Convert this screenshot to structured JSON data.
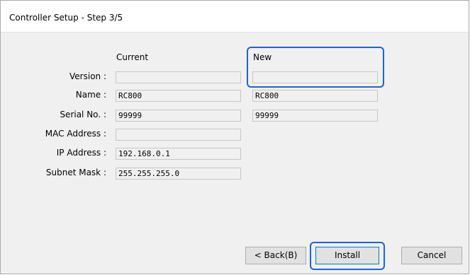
{
  "window": {
    "title": "Controller Setup - Step 3/5"
  },
  "columns": {
    "current": "Current",
    "new": "New"
  },
  "rows": [
    {
      "label": "Version :",
      "current": "",
      "new": "",
      "has_new": true
    },
    {
      "label": "Name :",
      "current": "RC800",
      "new": "RC800",
      "has_new": true
    },
    {
      "label": "Serial No. :",
      "current": "99999",
      "new": "99999",
      "has_new": true
    },
    {
      "label": "MAC Address :",
      "current": "",
      "has_new": false
    },
    {
      "label": "IP Address :",
      "current": "192.168.0.1",
      "has_new": false
    },
    {
      "label": "Subnet Mask :",
      "current": "255.255.255.0",
      "has_new": false
    }
  ],
  "buttons": {
    "back": "< Back(B)",
    "install": "Install",
    "cancel": "Cancel"
  },
  "colors": {
    "highlight": "#1a64d9",
    "window_bg": "#f0f0f0",
    "title_bg": "#ffffff"
  }
}
